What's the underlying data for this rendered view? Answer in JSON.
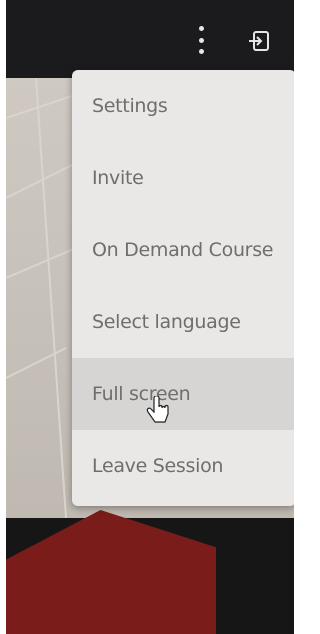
{
  "menu": {
    "items": [
      {
        "label": "Settings"
      },
      {
        "label": "Invite"
      },
      {
        "label": "On Demand Course"
      },
      {
        "label": "Select language"
      },
      {
        "label": "Full screen"
      },
      {
        "label": "Leave Session"
      }
    ],
    "highlighted_item": "Full screen"
  },
  "toolbar": {
    "more_icon": "kebab-vertical-icon",
    "exit_icon": "exit-session-icon"
  },
  "colors": {
    "toolbar_bg": "#1b1b1d",
    "menu_bg": "#e9e8e6",
    "menu_highlight": "#d6d5d3",
    "menu_text": "#6e6e6e"
  }
}
